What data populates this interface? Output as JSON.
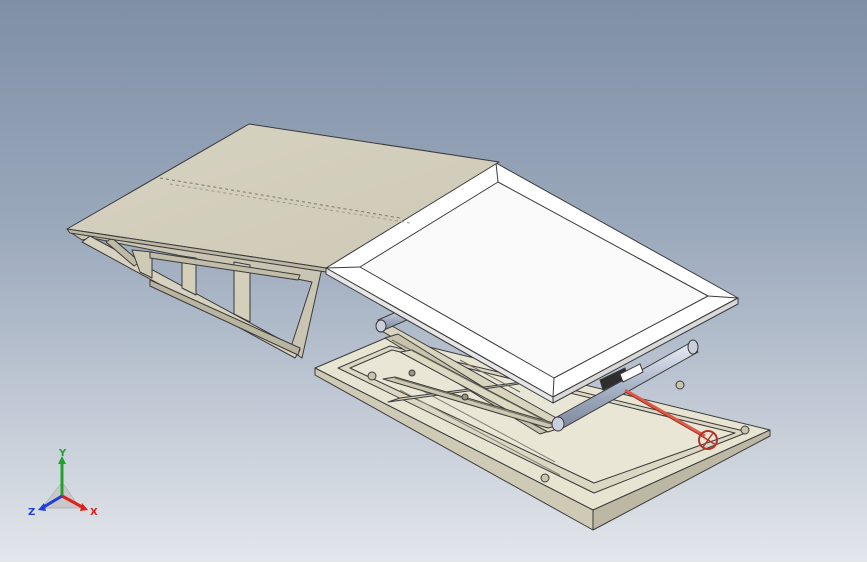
{
  "viewport": {
    "background_top": "#7f8fa6",
    "background_bottom": "#e3e6eb"
  },
  "model": {
    "ramp_color": "#d9d5c4",
    "platform_color": "#ffffff",
    "frame_color": "#e6e2cf",
    "edge_color": "#3a3a3a",
    "actuator_color": "#e05a4a",
    "cylinder_color": "#b9c2d6"
  },
  "triad": {
    "x_label": "X",
    "y_label": "Y",
    "z_label": "Z",
    "x_color": "#e0201a",
    "y_color": "#1fa32a",
    "z_color": "#1f3fd8"
  }
}
